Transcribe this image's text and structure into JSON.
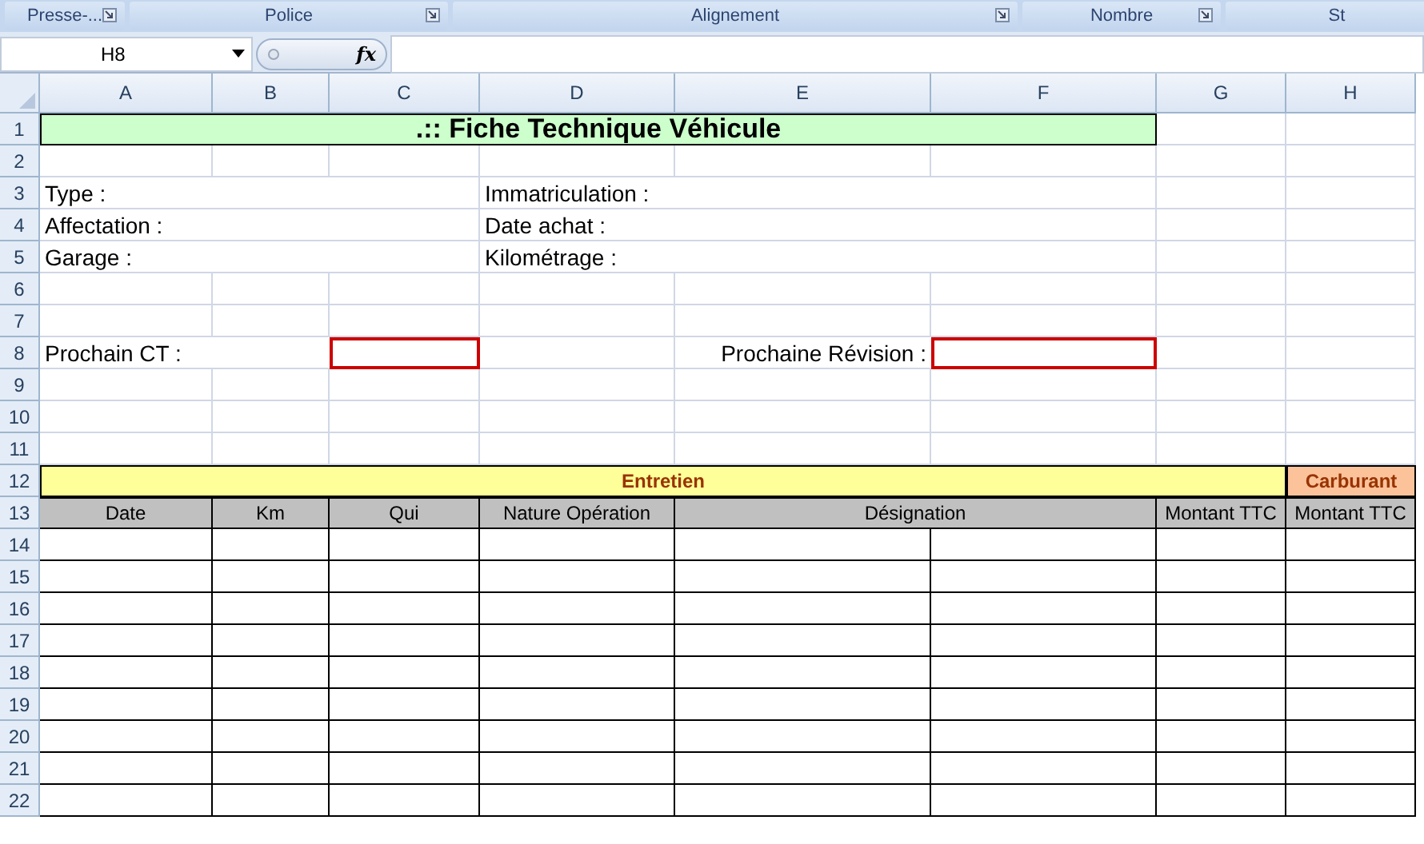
{
  "ribbon_groups": [
    {
      "label": "Presse-..."
    },
    {
      "label": "Police"
    },
    {
      "label": "Alignement"
    },
    {
      "label": "Nombre"
    },
    {
      "label": "St"
    }
  ],
  "name_box": "H8",
  "formula_icon": "fx",
  "columns": [
    "A",
    "B",
    "C",
    "D",
    "E",
    "F",
    "G",
    "H"
  ],
  "form_rows": [
    "1",
    "2",
    "3",
    "4",
    "5",
    "6",
    "7",
    "8",
    "9",
    "10",
    "11",
    "12",
    "13"
  ],
  "table_rows": [
    "14",
    "15",
    "16",
    "17",
    "18",
    "19",
    "20",
    "21",
    "22"
  ],
  "title": ".:: Fiche Technique Véhicule",
  "info_left": [
    "Type :",
    "Affectation :",
    "Garage :"
  ],
  "info_right": [
    "Immatriculation :",
    "Date achat :",
    "Kilométrage :"
  ],
  "due_dates": [
    {
      "label": "Prochain CT :"
    },
    {
      "label": "Prochaine Révision :"
    }
  ],
  "sections": [
    {
      "label": "Entretien",
      "kind": "maintenance"
    },
    {
      "label": "Carburant",
      "kind": "fuel"
    }
  ],
  "table_headers": [
    "Date",
    "Km",
    "Qui",
    "Nature Opération",
    "Désignation",
    "Montant TTC",
    "Montant TTC"
  ]
}
